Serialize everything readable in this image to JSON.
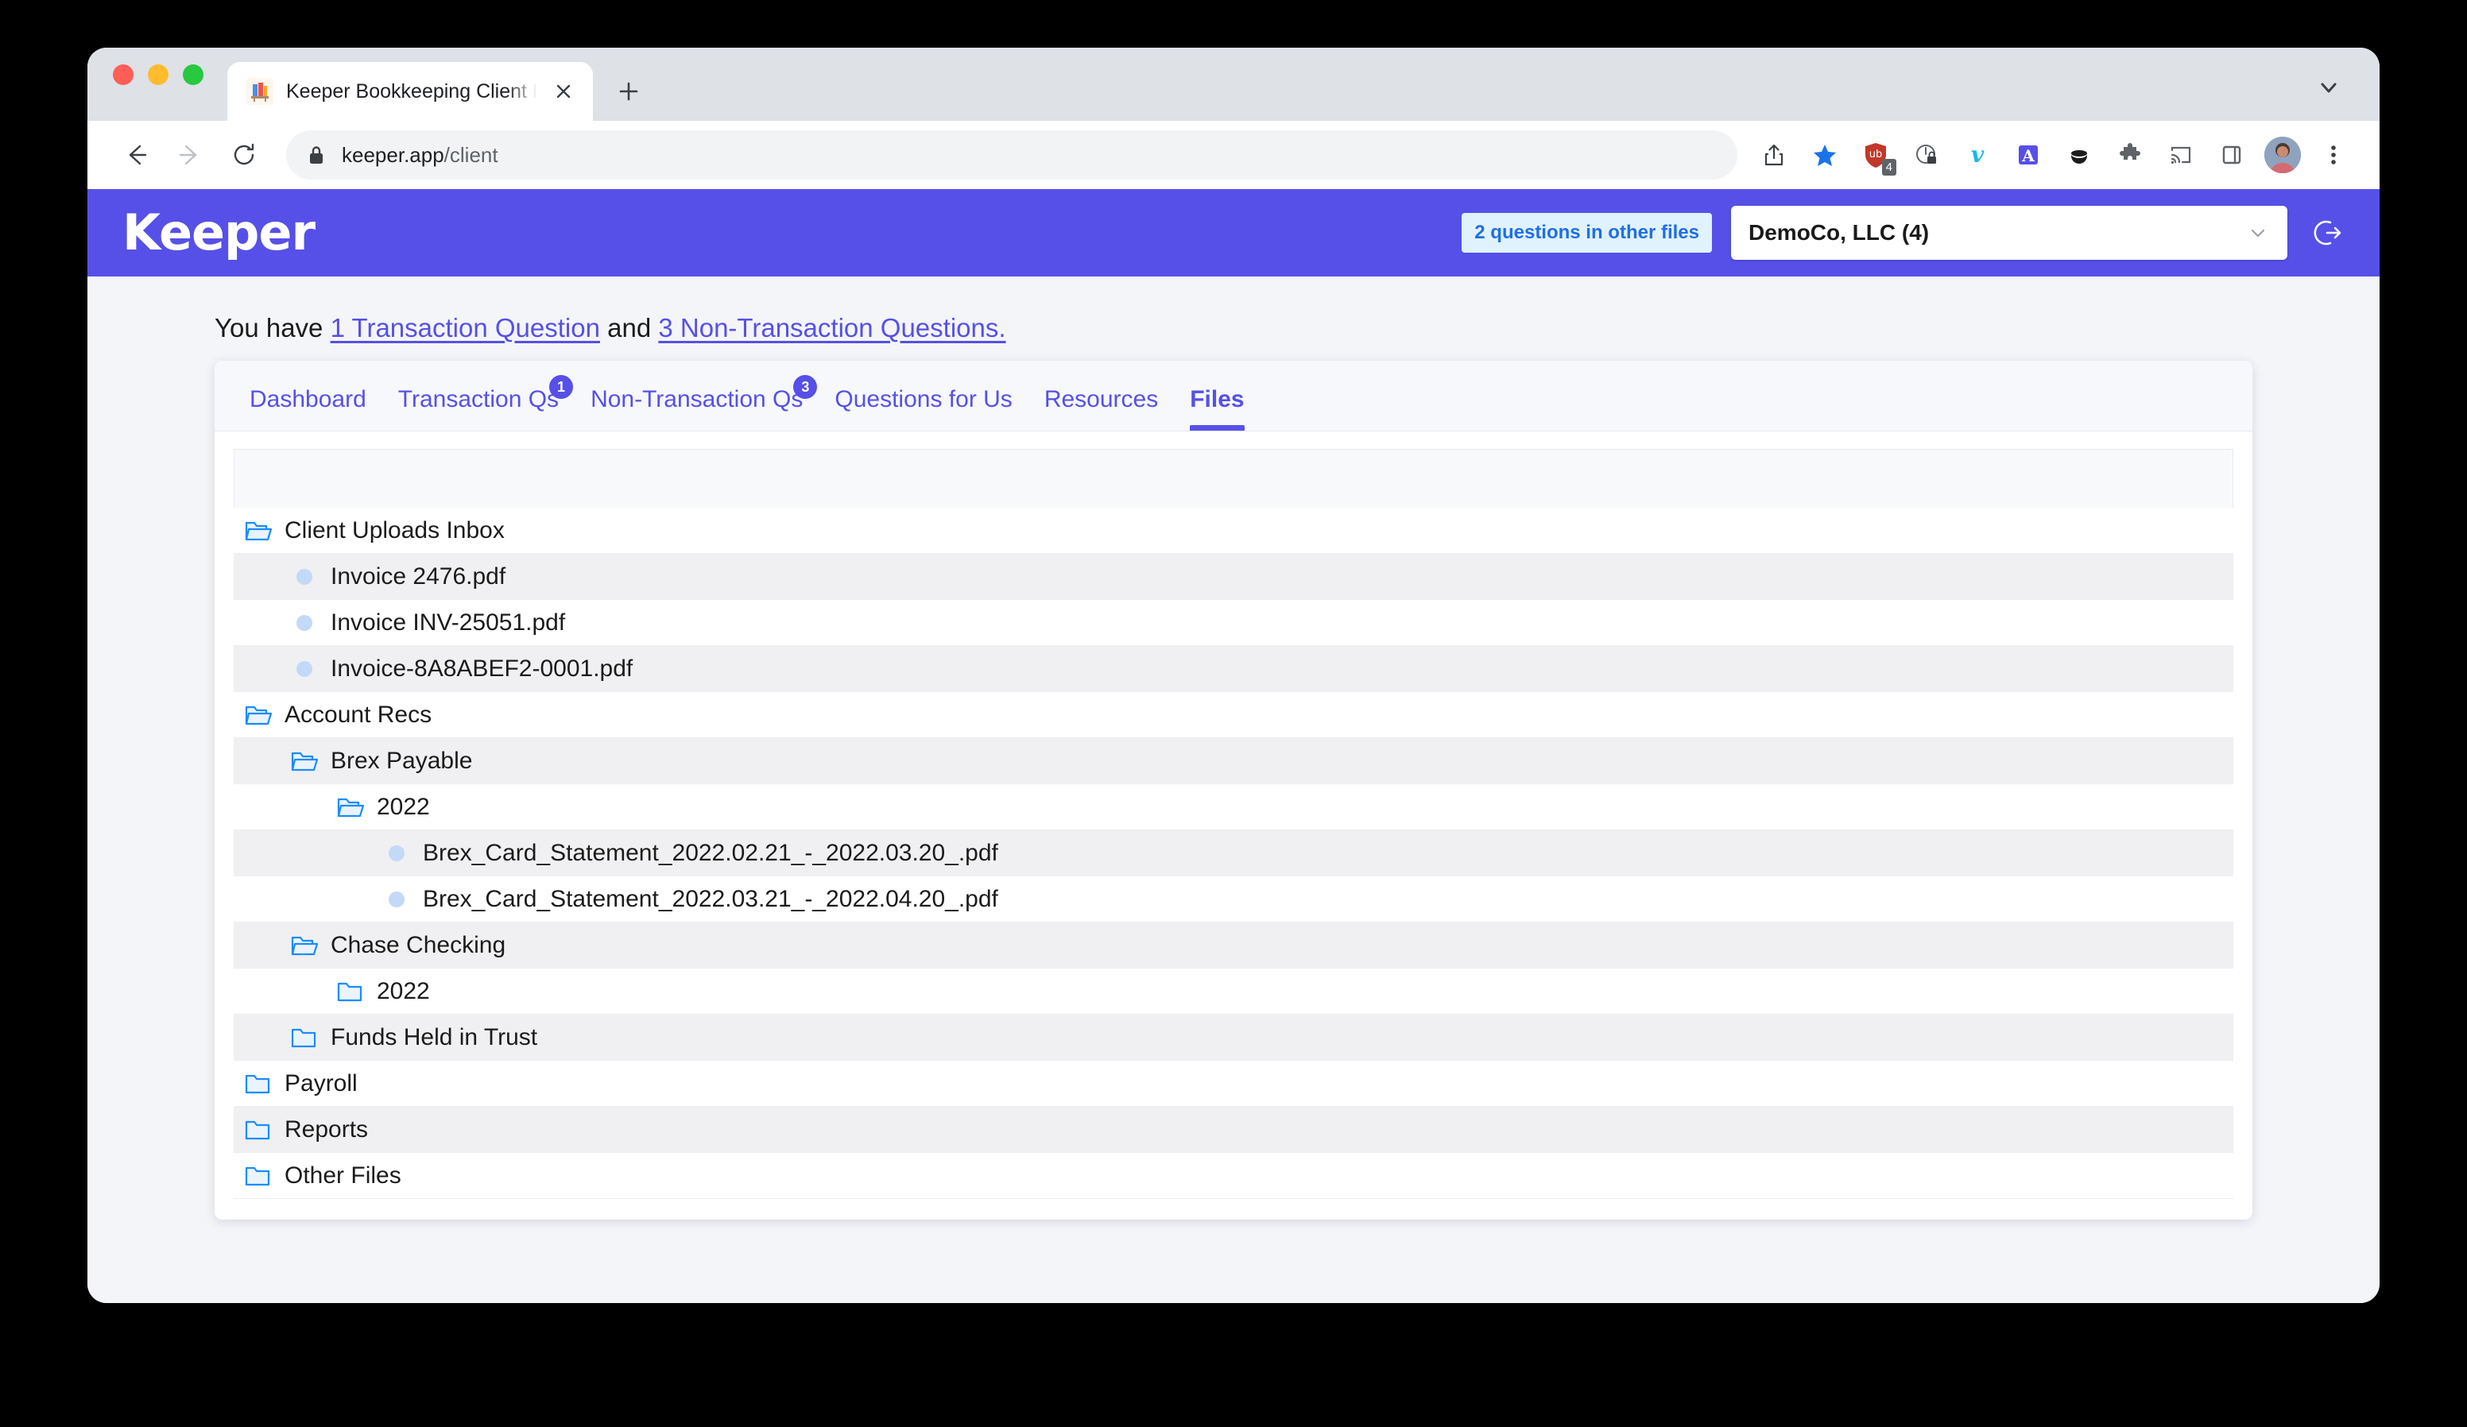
{
  "browser": {
    "tab": {
      "title": "Keeper Bookkeeping Client Por",
      "favicon_icon": "books-favicon",
      "close_icon": "close-icon"
    },
    "new_tab_icon": "plus-icon",
    "tabstrip_chevron_icon": "chevron-down-icon",
    "toolbar": {
      "back_icon": "arrow-left-icon",
      "forward_icon": "arrow-right-icon",
      "reload_icon": "reload-icon",
      "lock_icon": "lock-icon",
      "url_host": "keeper.app",
      "url_path": "/client",
      "icons": [
        {
          "name": "share-icon"
        },
        {
          "name": "bookmark-star-icon"
        },
        {
          "name": "ublock-shield-icon",
          "badge": "4"
        },
        {
          "name": "privacy-badger-icon"
        },
        {
          "name": "vimeo-icon"
        },
        {
          "name": "grammarly-icon"
        },
        {
          "name": "honey-icon"
        },
        {
          "name": "extensions-puzzle-icon"
        },
        {
          "name": "cast-icon"
        },
        {
          "name": "side-panel-icon"
        },
        {
          "name": "profile-avatar"
        },
        {
          "name": "chrome-menu-icon"
        }
      ]
    }
  },
  "app": {
    "brand": "Keeper",
    "questions_pill": "2 questions in other files",
    "client_selector": {
      "value": "DemoCo, LLC (4)",
      "caret_icon": "chevron-down-icon"
    },
    "logout_icon": "logout-icon",
    "notice": {
      "prefix": "You have ",
      "link1": "1 Transaction Question",
      "middle": " and ",
      "link2": "3 Non-Transaction Questions."
    },
    "tabs": [
      {
        "label": "Dashboard",
        "badge": null,
        "active": false
      },
      {
        "label": "Transaction Qs",
        "badge": "1",
        "active": false
      },
      {
        "label": "Non-Transaction Qs",
        "badge": "3",
        "active": false
      },
      {
        "label": "Questions for Us",
        "badge": null,
        "active": false
      },
      {
        "label": "Resources",
        "badge": null,
        "active": false
      },
      {
        "label": "Files",
        "badge": null,
        "active": true
      }
    ],
    "files": [
      {
        "label": "Client Uploads Inbox",
        "type": "folder-open",
        "depth": 0
      },
      {
        "label": "Invoice 2476.pdf",
        "type": "file",
        "depth": 1
      },
      {
        "label": "Invoice INV-25051.pdf",
        "type": "file",
        "depth": 1
      },
      {
        "label": "Invoice-8A8ABEF2-0001.pdf",
        "type": "file",
        "depth": 1
      },
      {
        "label": "Account Recs",
        "type": "folder-open",
        "depth": 0
      },
      {
        "label": "Brex Payable",
        "type": "folder-open",
        "depth": 1
      },
      {
        "label": "2022",
        "type": "folder-open",
        "depth": 2
      },
      {
        "label": "Brex_Card_Statement_2022.02.21_-_2022.03.20_.pdf",
        "type": "file",
        "depth": 3
      },
      {
        "label": "Brex_Card_Statement_2022.03.21_-_2022.04.20_.pdf",
        "type": "file",
        "depth": 3
      },
      {
        "label": "Chase Checking",
        "type": "folder-open",
        "depth": 1
      },
      {
        "label": "2022",
        "type": "folder-closed",
        "depth": 2
      },
      {
        "label": "Funds Held in Trust",
        "type": "folder-closed",
        "depth": 1
      },
      {
        "label": "Payroll",
        "type": "folder-closed",
        "depth": 0
      },
      {
        "label": "Reports",
        "type": "folder-closed",
        "depth": 0
      },
      {
        "label": "Other Files",
        "type": "folder-closed",
        "depth": 0
      }
    ]
  },
  "colors": {
    "brand_purple": "#5650e8",
    "folder_blue": "#1a8cff",
    "file_dot": "#c3d9f8",
    "pill_bg": "#e0f2fe",
    "pill_text": "#1f6fe5"
  }
}
